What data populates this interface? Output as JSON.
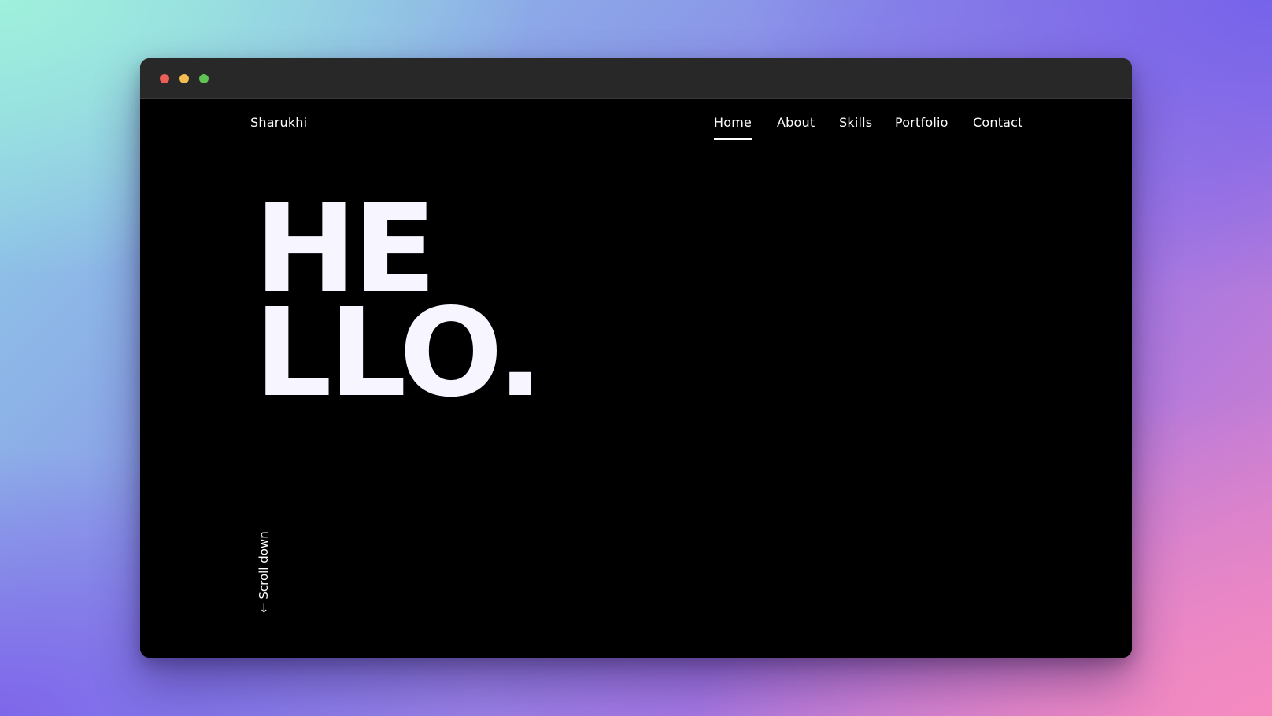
{
  "window": {
    "controls": [
      "close",
      "minimize",
      "maximize"
    ]
  },
  "header": {
    "brand": "Sharukhi",
    "nav": [
      {
        "label": "Home",
        "active": true
      },
      {
        "label": "About",
        "active": false
      },
      {
        "label": "Skills",
        "active": false
      },
      {
        "label": "Portfolio",
        "active": false
      },
      {
        "label": "Contact",
        "active": false
      }
    ]
  },
  "hero": {
    "line1": "HE",
    "line2": "LLO."
  },
  "scroll_hint": "← Scroll down",
  "colors": {
    "page_background": "#000000",
    "titlebar": "#282828",
    "text": "#ffffff",
    "close": "#ec5f58",
    "minimize": "#f4bd4f",
    "maximize": "#5fc454"
  }
}
